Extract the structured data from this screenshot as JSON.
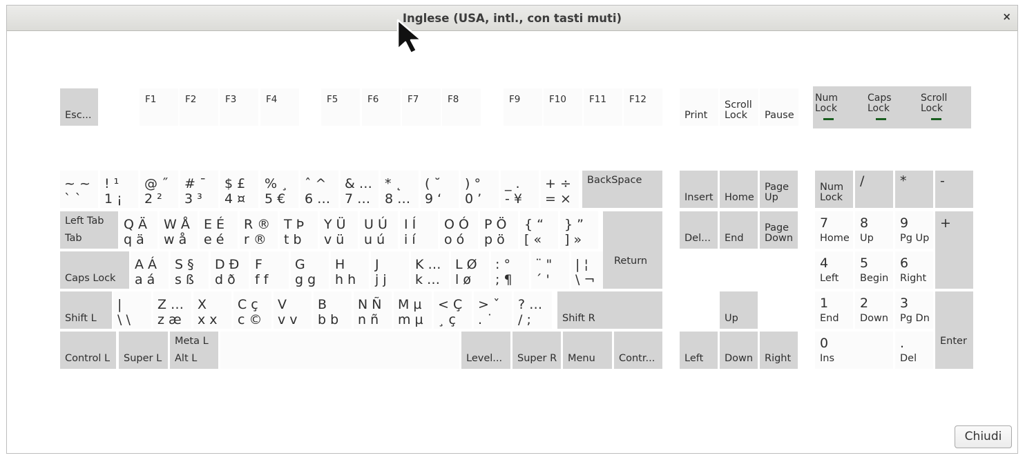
{
  "window": {
    "title": "Inglese (USA, intl., con tasti muti)",
    "close_glyph": "×",
    "close_button_label": "Chiudi"
  },
  "colors": {
    "key_gray": "#d4d4d4",
    "key_white": "#fbfbfb",
    "led": "#1a5e20"
  },
  "indicators": [
    {
      "label": "Num\nLock"
    },
    {
      "label": "Caps\nLock"
    },
    {
      "label": "Scroll\nLock"
    }
  ],
  "keys": {
    "esc": "Esc...",
    "f1": "F1",
    "f2": "F2",
    "f3": "F3",
    "f4": "F4",
    "f5": "F5",
    "f6": "F6",
    "f7": "F7",
    "f8": "F8",
    "f9": "F9",
    "f10": "F10",
    "f11": "F11",
    "f12": "F12",
    "print": "Print",
    "scroll_lock": "Scroll\nLock",
    "pause": "Pause",
    "backspace": "BackSpace",
    "tab_top": "Left Tab",
    "tab_bottom": "Tab",
    "return": "Return",
    "caps_lock": "Caps Lock",
    "shift_l": "Shift L",
    "shift_r": "Shift R",
    "control_l": "Control L",
    "super_l": "Super L",
    "meta_l": "Meta L",
    "alt_l": "Alt L",
    "level3": "Level...",
    "super_r": "Super R",
    "menu": "Menu",
    "control_r": "Contr...",
    "insert": "Insert",
    "home": "Home",
    "page_up": "Page\nUp",
    "delete": "Del...",
    "end": "End",
    "page_down": "Page\nDown",
    "up": "Up",
    "left": "Left",
    "down": "Down",
    "right": "Right",
    "np_numlock": "Num\nLock",
    "np_div": "/",
    "np_mul": "*",
    "np_minus": "-",
    "np_plus": "+",
    "np_enter": "Enter",
    "np7": "7",
    "np7b": "Home",
    "np8": "8",
    "np8b": "Up",
    "np9": "9",
    "np9b": "Pg Up",
    "np4": "4",
    "np4b": "Left",
    "np5": "5",
    "np5b": "Begin",
    "np6": "6",
    "np6b": "Right",
    "np1": "1",
    "np1b": "End",
    "np2": "2",
    "np2b": "Down",
    "np3": "3",
    "np3b": "Pg Dn",
    "np0": "0",
    "np0b": "Ins",
    "npdot": ".",
    "npdotb": "Del"
  },
  "char_keys": {
    "row1": [
      [
        "~ ~",
        "` `"
      ],
      [
        "! ¹",
        "1 ¡"
      ],
      [
        "@ ˝",
        "2 ²"
      ],
      [
        "# ¯",
        "3 ³"
      ],
      [
        "$ £",
        "4 ¤"
      ],
      [
        "% ¸",
        "5 €"
      ],
      [
        "ˆ ^",
        "6 …"
      ],
      [
        "& …",
        "7 …"
      ],
      [
        "* ˛",
        "8 …"
      ],
      [
        "( ˘",
        "9 ‘"
      ],
      [
        ") °",
        "0 ’"
      ],
      [
        "_ .",
        "- ¥"
      ],
      [
        "+ ÷",
        "= ×"
      ]
    ],
    "row2": [
      [
        "Q Ä",
        "q ä"
      ],
      [
        "W Å",
        "w å"
      ],
      [
        "E É",
        "e é"
      ],
      [
        "R ®",
        "r ®"
      ],
      [
        "T Þ",
        "t b"
      ],
      [
        "Y Ü",
        "v ü"
      ],
      [
        "U Ú",
        "u ú"
      ],
      [
        "I Í",
        "i í"
      ],
      [
        "O Ó",
        "o ó"
      ],
      [
        "P Ö",
        "p ö"
      ],
      [
        "{ “",
        "[ «"
      ],
      [
        "} ”",
        "] »"
      ]
    ],
    "row3": [
      [
        "A Á",
        "a á"
      ],
      [
        "S §",
        "s ß"
      ],
      [
        "D Đ",
        "d ð"
      ],
      [
        "F",
        "f f"
      ],
      [
        "G",
        "g g"
      ],
      [
        "H",
        "h h"
      ],
      [
        "J",
        "j j"
      ],
      [
        "K …",
        "k …"
      ],
      [
        "L Ø",
        "l ø"
      ],
      [
        ": °",
        "; ¶"
      ],
      [
        "¨ \"",
        "´ '"
      ],
      [
        "| ¦",
        "\\ ¬"
      ]
    ],
    "row4": [
      [
        "|",
        "\\ \\"
      ],
      [
        "Z …",
        "z æ"
      ],
      [
        "X",
        "x x"
      ],
      [
        "C ç",
        "c ©"
      ],
      [
        "V",
        "v v"
      ],
      [
        "B",
        "b b"
      ],
      [
        "N Ñ",
        "n ñ"
      ],
      [
        "M µ",
        "m µ"
      ],
      [
        "< Ç",
        "¸ ç"
      ],
      [
        "> ˇ",
        ". ˙"
      ],
      [
        "? …",
        "/ ;"
      ]
    ]
  }
}
